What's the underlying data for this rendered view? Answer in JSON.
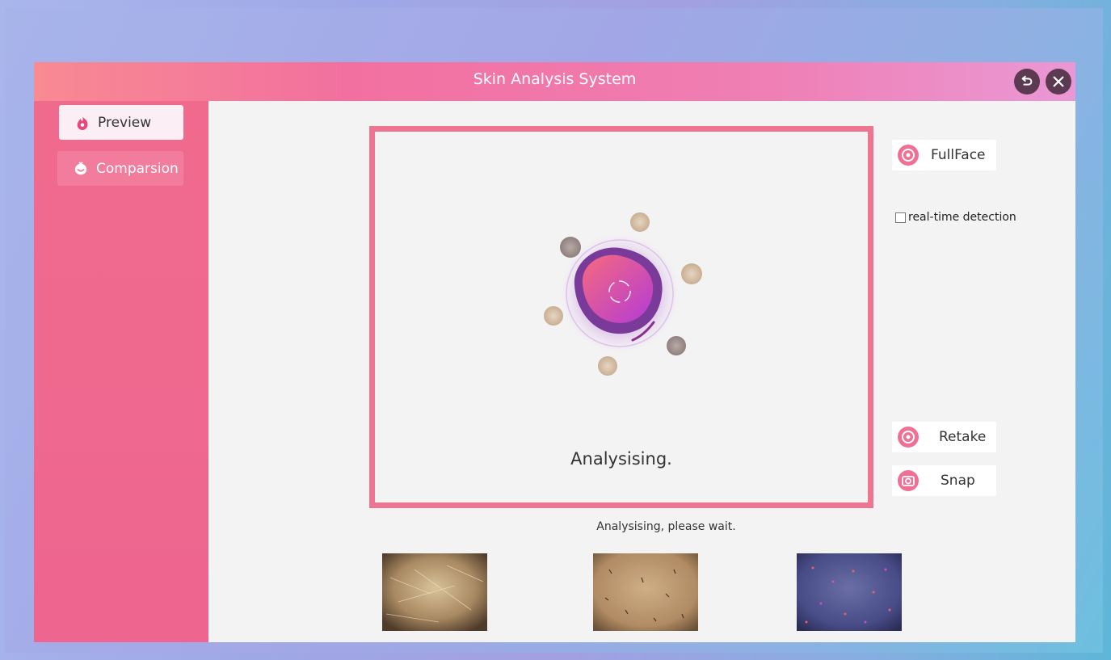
{
  "window": {
    "title": "Skin Analysis System"
  },
  "titlebar": {
    "back_icon": "undo-icon",
    "close_icon": "close-icon"
  },
  "sidebar": {
    "items": [
      {
        "label": "Preview",
        "icon": "flame-icon",
        "active": true
      },
      {
        "label": "Comparsion",
        "icon": "face-icon",
        "active": false
      }
    ]
  },
  "viewer": {
    "status_text": "Analysising."
  },
  "controls": {
    "fullface_label": "FullFace",
    "realtime_label": "real-time detection",
    "realtime_checked": false,
    "retake_label": "Retake",
    "snap_label": "Snap"
  },
  "status_message": "Analysising, please wait.",
  "thumbnails": [
    {
      "name": "skin-thumbnail-1"
    },
    {
      "name": "skin-thumbnail-2"
    },
    {
      "name": "skin-thumbnail-3-uv"
    }
  ],
  "colors": {
    "accent": "#ee7592",
    "sidebar": "#ee6690",
    "titlebar_start": "#f88a92",
    "titlebar_end": "#ea98d5"
  }
}
